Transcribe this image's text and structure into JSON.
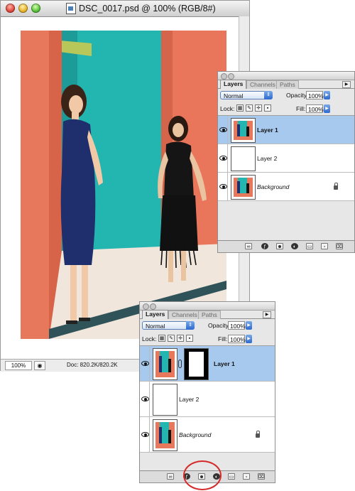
{
  "document": {
    "title": "DSC_0017.psd @ 100% (RGB/8#)",
    "zoom": "100%",
    "doc_size": "Doc: 820.2K/820.2K"
  },
  "layers_panels": [
    {
      "tabs": [
        "Layers",
        "Channels",
        "Paths"
      ],
      "blend_mode": "Normal",
      "opacity_label": "Opacity:",
      "opacity": "100%",
      "lock_label": "Lock:",
      "fill_label": "Fill:",
      "fill": "100%",
      "layers": [
        {
          "name": "Layer 1",
          "selected": true,
          "has_mask": false
        },
        {
          "name": "Layer 2",
          "selected": false,
          "has_mask": false
        },
        {
          "name": "Background",
          "selected": false,
          "locked": true
        }
      ]
    },
    {
      "tabs": [
        "Layers",
        "Channels",
        "Paths"
      ],
      "blend_mode": "Normal",
      "opacity_label": "Opacity:",
      "opacity": "100%",
      "lock_label": "Lock:",
      "fill_label": "Fill:",
      "fill": "100%",
      "layers": [
        {
          "name": "Layer 1",
          "selected": true,
          "has_mask": true
        },
        {
          "name": "Layer 2",
          "selected": false,
          "has_mask": false
        },
        {
          "name": "Background",
          "selected": false,
          "locked": true
        }
      ]
    }
  ],
  "colors": {
    "selection": "#a7c9ee",
    "aqua_blue": "#2d6ad0",
    "callout_red": "#d62a2a",
    "wall_coral": "#e67b5e",
    "wall_teal": "#23b5b0"
  },
  "icons": [
    "eye-icon",
    "lock-icon",
    "chain-link-icon",
    "add-layer-mask-icon",
    "trash-icon",
    "new-layer-icon",
    "new-folder-icon",
    "layer-style-icon",
    "adjustment-layer-icon",
    "link-layers-icon"
  ]
}
